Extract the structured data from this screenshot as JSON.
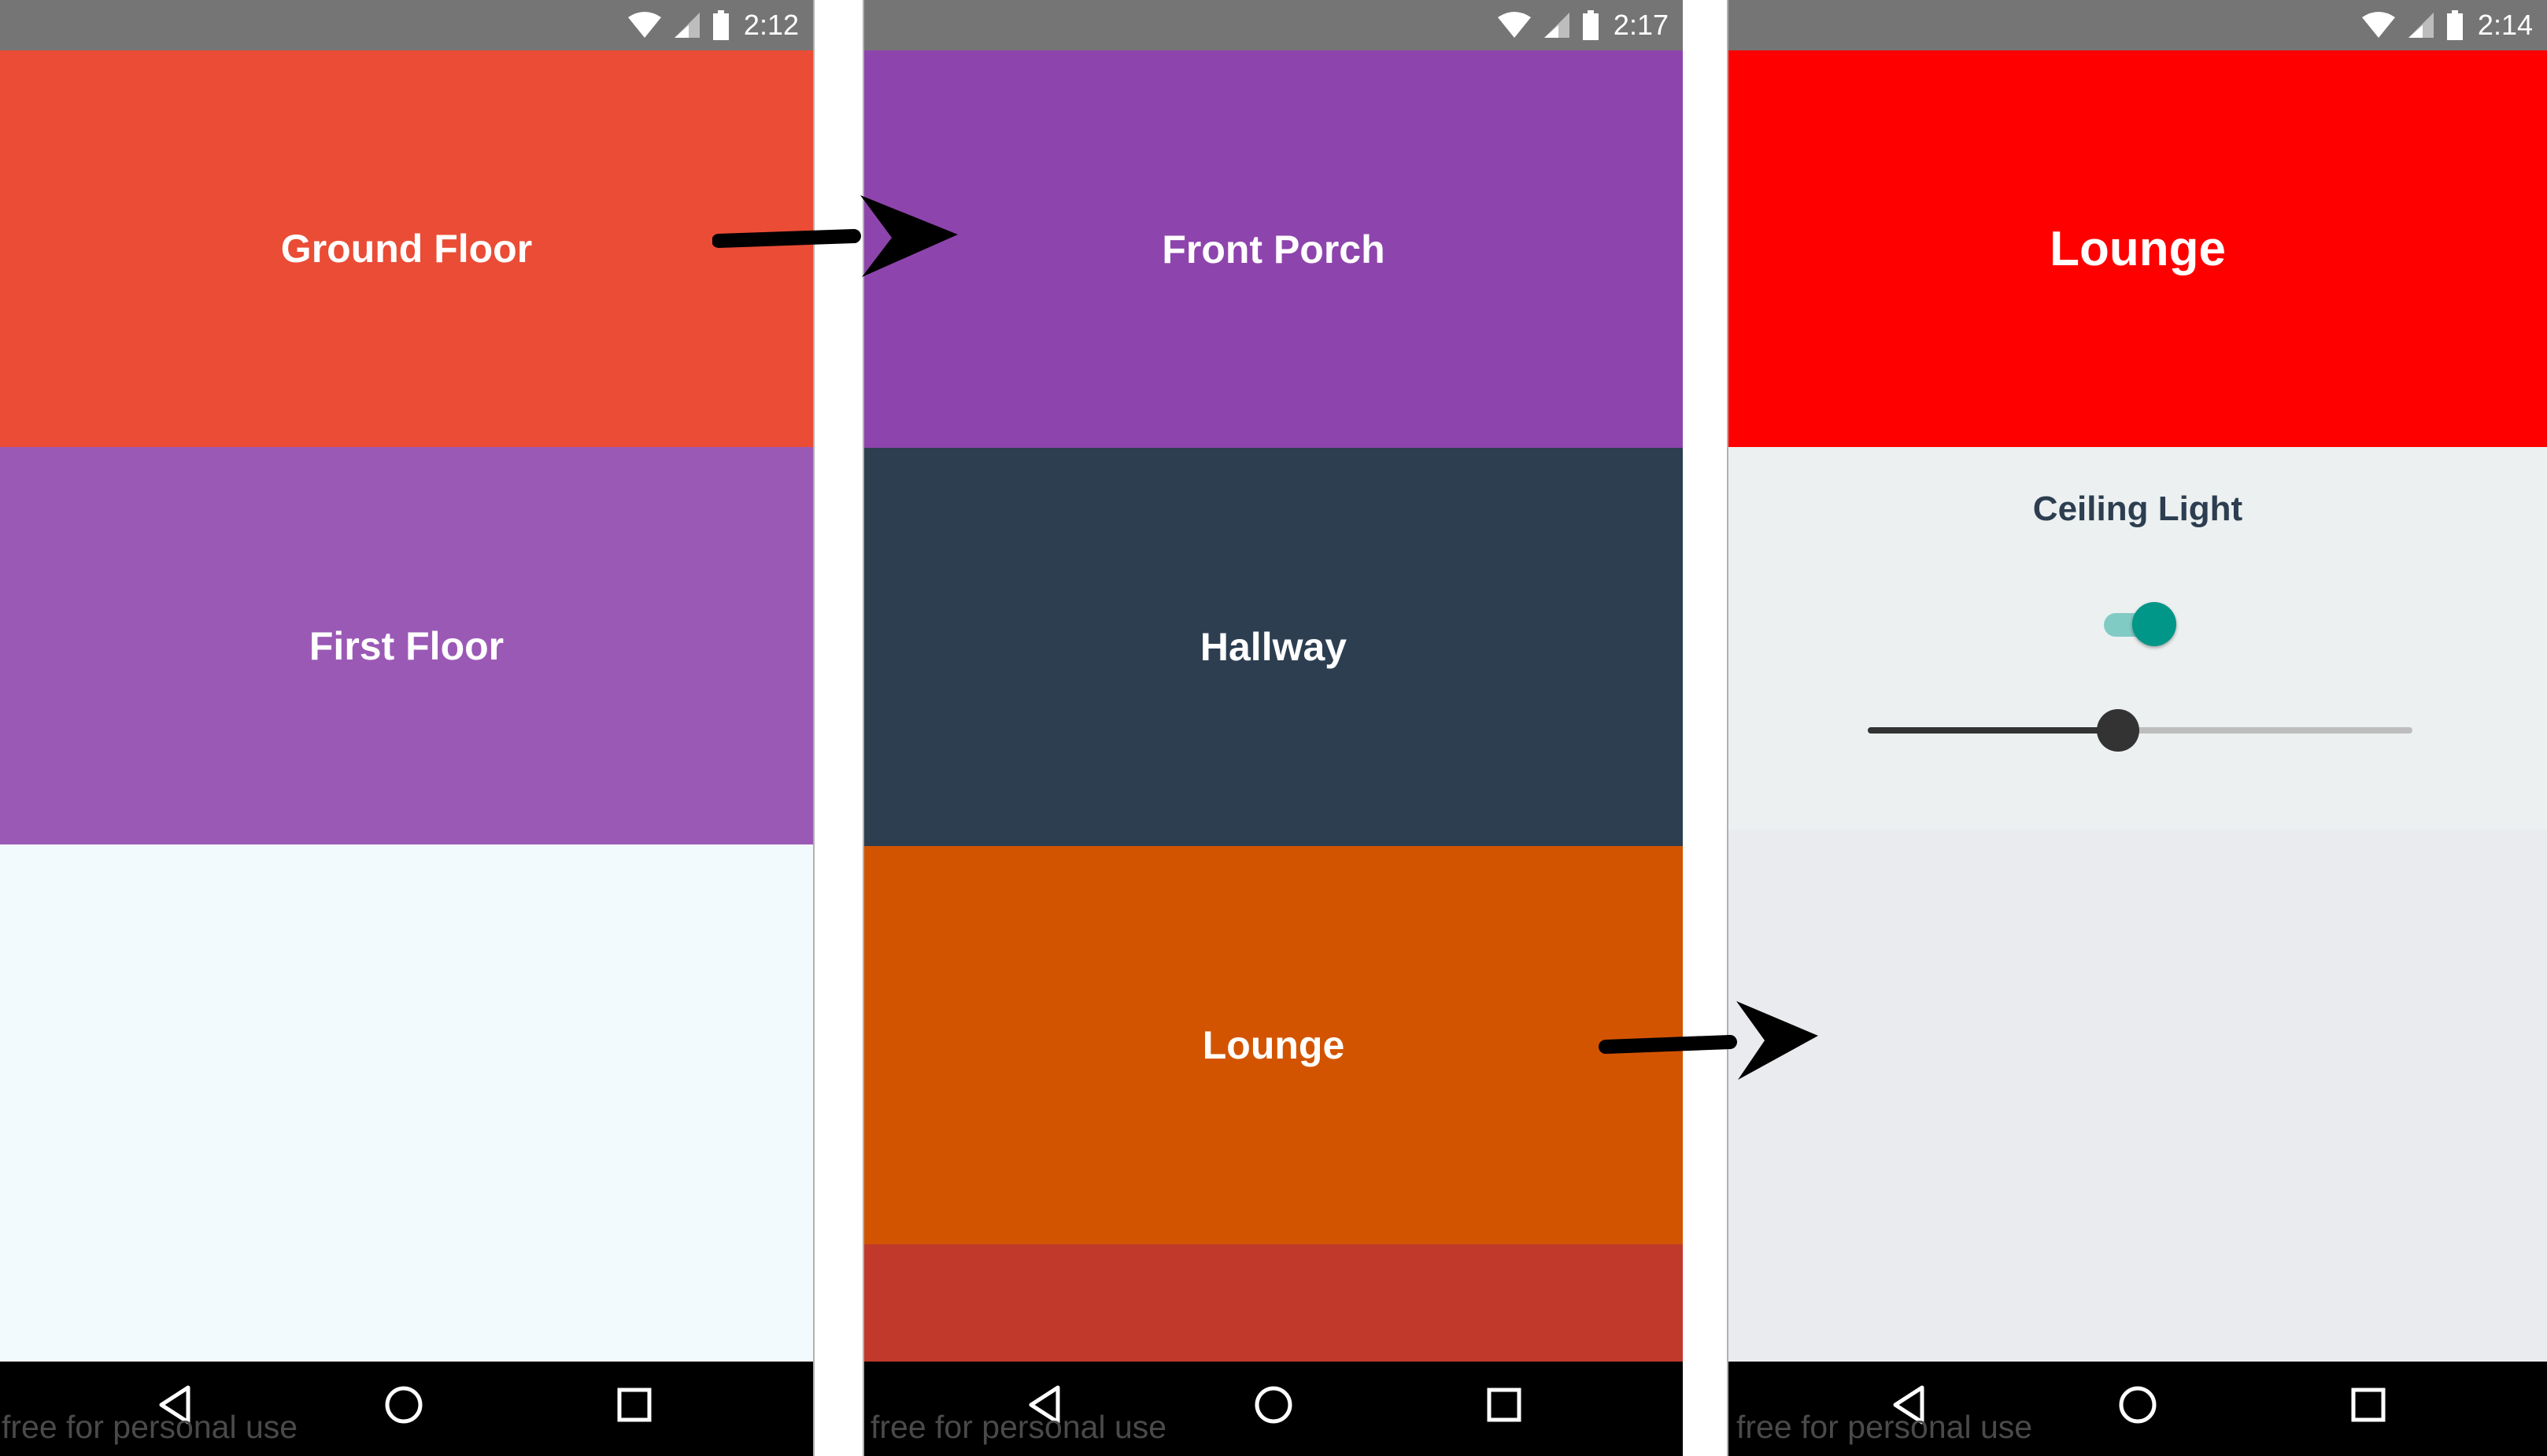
{
  "colors": {
    "status_bar": "#757575",
    "nav_bar": "#000000",
    "switch_on": "#009688",
    "switch_track": "#80cbc4",
    "slider_active": "#333333",
    "slider_rail": "#bdbdbd",
    "title_text": "#2c3e50"
  },
  "watermark": "free for personal use",
  "screens": [
    {
      "status_time": "2:12",
      "tiles": [
        {
          "label": "Ground Floor",
          "color": "#ea4c36"
        },
        {
          "label": "First Floor",
          "color": "#9b59b6"
        },
        {
          "label": "",
          "color": "#f3fafe"
        }
      ]
    },
    {
      "status_time": "2:17",
      "tiles": [
        {
          "label": "Front Porch",
          "color": "#8e44ad"
        },
        {
          "label": "Hallway",
          "color": "#2c3e50"
        },
        {
          "label": "Lounge",
          "color": "#d35400"
        },
        {
          "label": "",
          "color": "#c0392b"
        }
      ]
    },
    {
      "status_time": "2:14",
      "header": {
        "label": "Lounge",
        "color": "#ff0000"
      },
      "panel_color": "#ecf0f1",
      "empty_color": "#e9ebee",
      "light": {
        "name": "Ceiling Light",
        "on": true,
        "brightness": 0.46
      }
    }
  ],
  "icons": {
    "status": [
      "wifi-icon",
      "signal-icon",
      "battery-icon"
    ],
    "nav": [
      "back-icon",
      "home-icon",
      "recents-icon"
    ],
    "arrows": [
      "arrow-right-icon"
    ]
  }
}
